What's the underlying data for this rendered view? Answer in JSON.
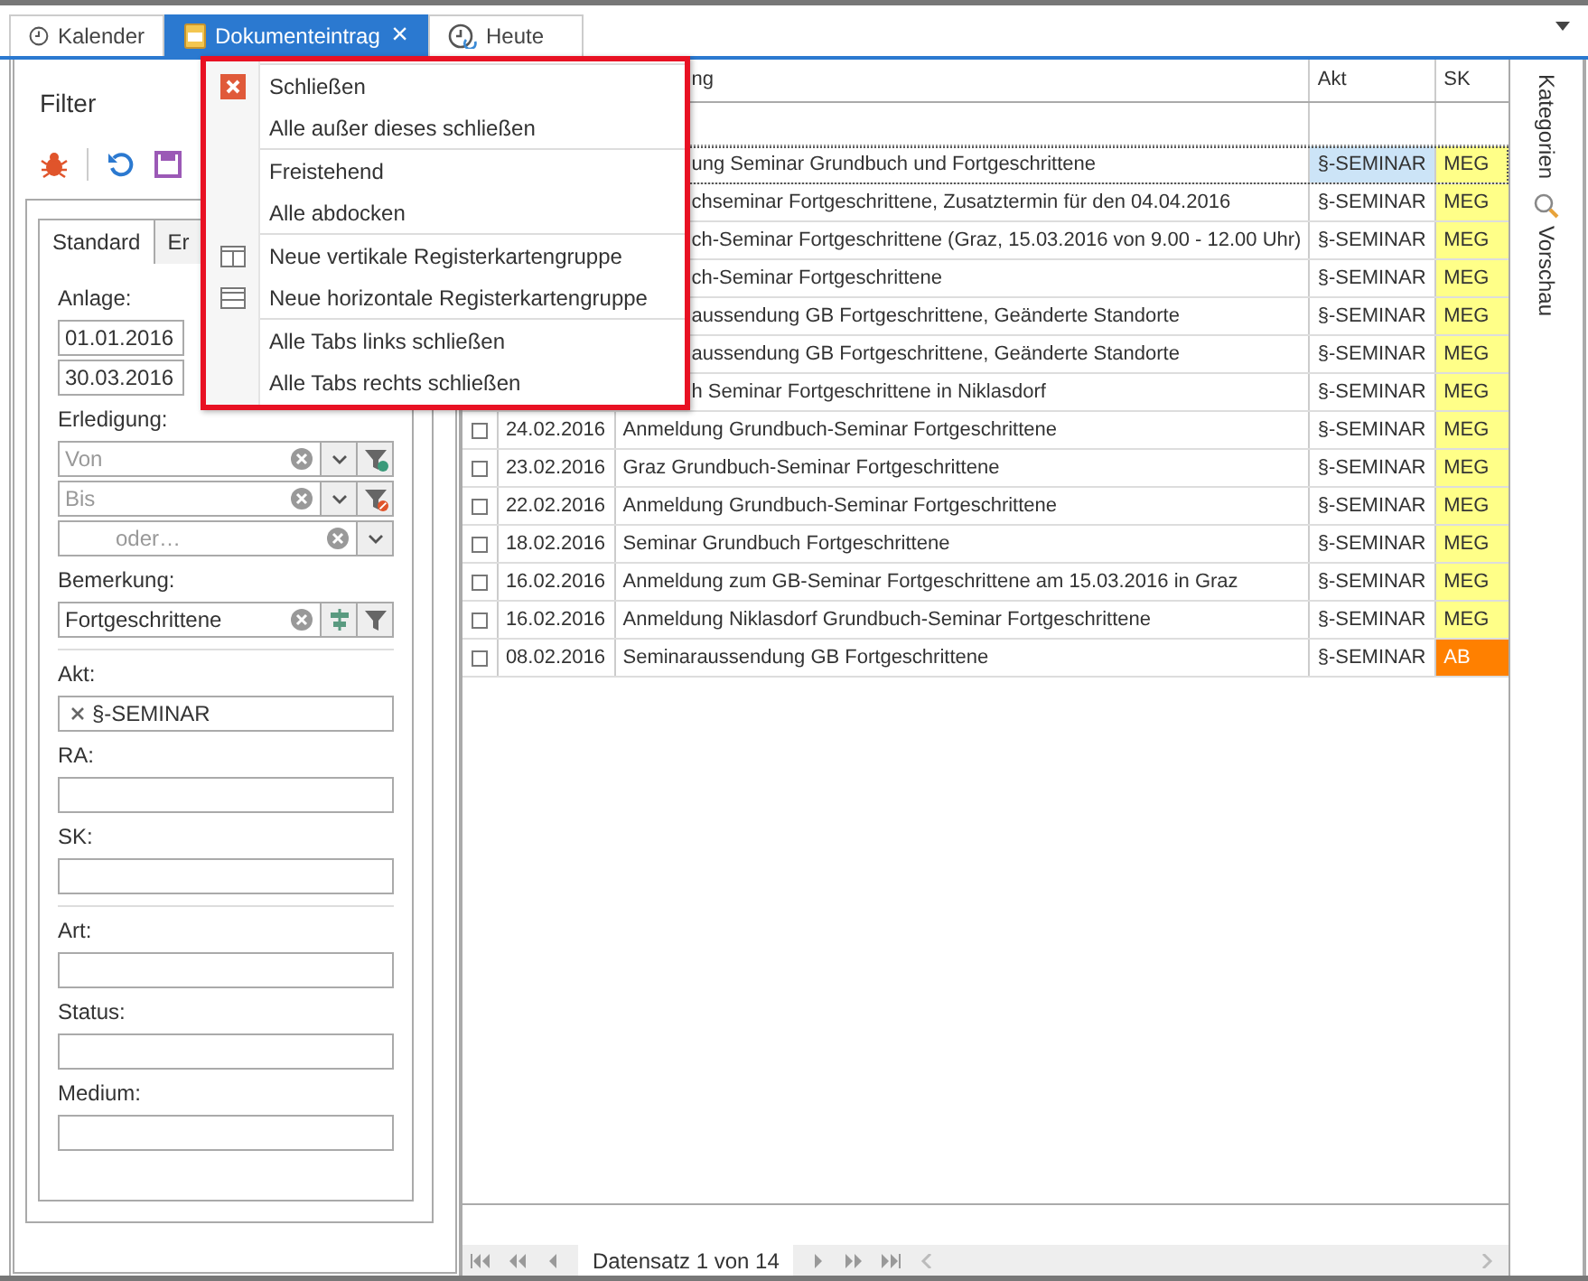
{
  "document_tabs": [
    {
      "label": "Kalender",
      "selected": false
    },
    {
      "label": "Dokumenteintrag",
      "selected": true,
      "close": "×"
    },
    {
      "label": "Heute",
      "selected": false
    }
  ],
  "filter_panel": {
    "title": "Filter",
    "tabs": [
      {
        "label": "Standard",
        "selected": true
      },
      {
        "label": "Er",
        "selected": false
      }
    ],
    "fields": [
      {
        "kind": "label",
        "text": "Anlage:"
      },
      {
        "kind": "date",
        "value": "01.01.2016"
      },
      {
        "kind": "date",
        "value": "30.03.2016"
      },
      {
        "kind": "label",
        "text": "Erledigung:"
      },
      {
        "kind": "combo",
        "placeholder": "Von"
      },
      {
        "kind": "combo",
        "placeholder": "Bis"
      },
      {
        "kind": "combo",
        "placeholder": "oder…"
      },
      {
        "kind": "label",
        "text": "Bemerkung:"
      },
      {
        "kind": "search",
        "value": "Fortgeschrittene"
      },
      {
        "kind": "divider"
      },
      {
        "kind": "label",
        "text": "Akt:"
      },
      {
        "kind": "tags",
        "tags": [
          "§-SEMINAR"
        ]
      },
      {
        "kind": "label",
        "text": "RA:"
      },
      {
        "kind": "text"
      },
      {
        "kind": "label",
        "text": "SK:"
      },
      {
        "kind": "text"
      },
      {
        "kind": "divider"
      },
      {
        "kind": "label",
        "text": "Art:"
      },
      {
        "kind": "text"
      },
      {
        "kind": "label",
        "text": "Status:"
      },
      {
        "kind": "text"
      },
      {
        "kind": "label",
        "text": "Medium:"
      },
      {
        "kind": "text"
      }
    ]
  },
  "grid": {
    "columns": [
      "ng",
      "Akt",
      "SK"
    ],
    "rows": [
      {
        "description": "ung Seminar Grundbuch und Fortgeschrittene",
        "akt": "§-SEMINAR",
        "sk": "MEG",
        "color": "#ffff88",
        "selected": true
      },
      {
        "description": "chseminar Fortgeschrittene,  Zusatztermin für den 04.04.2016",
        "akt": "§-SEMINAR",
        "sk": "MEG",
        "color": "#ffff88",
        "selected": false
      },
      {
        "description": "ch-Seminar Fortgeschrittene (Graz, 15.03.2016 von 9.00 - 12.00 Uhr)",
        "akt": "§-SEMINAR",
        "sk": "MEG",
        "color": "#ffff88",
        "selected": false
      },
      {
        "description": "ch-Seminar Fortgeschrittene",
        "akt": "§-SEMINAR",
        "sk": "MEG",
        "color": "#ffff88",
        "selected": false
      },
      {
        "description": "aussendung GB Fortgeschrittene, Geänderte Standorte",
        "akt": "§-SEMINAR",
        "sk": "MEG",
        "color": "#ffff88",
        "selected": false
      },
      {
        "description": "aussendung GB Fortgeschrittene, Geänderte Standorte",
        "akt": "§-SEMINAR",
        "sk": "MEG",
        "color": "#ffff88",
        "selected": false
      },
      {
        "description": "h Seminar Fortgeschrittene in Niklasdorf",
        "akt": "§-SEMINAR",
        "sk": "MEG",
        "color": "#ffff88",
        "selected": false
      },
      {
        "date": "24.02.2016",
        "description": "Anmeldung Grundbuch-Seminar Fortgeschrittene",
        "akt": "§-SEMINAR",
        "sk": "MEG",
        "color": "#ffff88",
        "selected": false
      },
      {
        "date": "23.02.2016",
        "description": "Graz Grundbuch-Seminar Fortgeschrittene",
        "akt": "§-SEMINAR",
        "sk": "MEG",
        "color": "#ffff88",
        "selected": false
      },
      {
        "date": "22.02.2016",
        "description": "Anmeldung Grundbuch-Seminar Fortgeschrittene",
        "akt": "§-SEMINAR",
        "sk": "MEG",
        "color": "#ffff88",
        "selected": false
      },
      {
        "date": "18.02.2016",
        "description": "Seminar Grundbuch Fortgeschrittene",
        "akt": "§-SEMINAR",
        "sk": "MEG",
        "color": "#ffff88",
        "selected": false
      },
      {
        "date": "16.02.2016",
        "description": "Anmeldung zum GB-Seminar Fortgeschrittene am 15.03.2016 in Graz",
        "akt": "§-SEMINAR",
        "sk": "MEG",
        "color": "#ffff88",
        "selected": false
      },
      {
        "date": "16.02.2016",
        "description": "Anmeldung Niklasdorf Grundbuch-Seminar Fortgeschrittene",
        "akt": "§-SEMINAR",
        "sk": "MEG",
        "color": "#ffff88",
        "selected": false
      },
      {
        "date": "08.02.2016",
        "description": "Seminaraussendung GB Fortgeschrittene",
        "akt": "§-SEMINAR",
        "sk": "AB",
        "color": "#ff8000",
        "selected": false
      }
    ],
    "pager": "Datensatz 1 von 14"
  },
  "side_tabs": [
    {
      "label": "Kategorien"
    },
    {
      "label": "Vorschau"
    }
  ],
  "context_menu": [
    [
      {
        "label": "Schließen"
      },
      {
        "label": "Alle außer dieses schließen"
      }
    ],
    [
      {
        "label": "Freistehend"
      },
      {
        "label": "Alle abdocken"
      }
    ],
    [
      {
        "label": "Neue vertikale Registerkartengruppe"
      },
      {
        "label": "Neue horizontale Registerkartengruppe"
      }
    ],
    [
      {
        "label": "Alle Tabs links schließen"
      },
      {
        "label": "Alle Tabs rechts schließen"
      }
    ]
  ]
}
